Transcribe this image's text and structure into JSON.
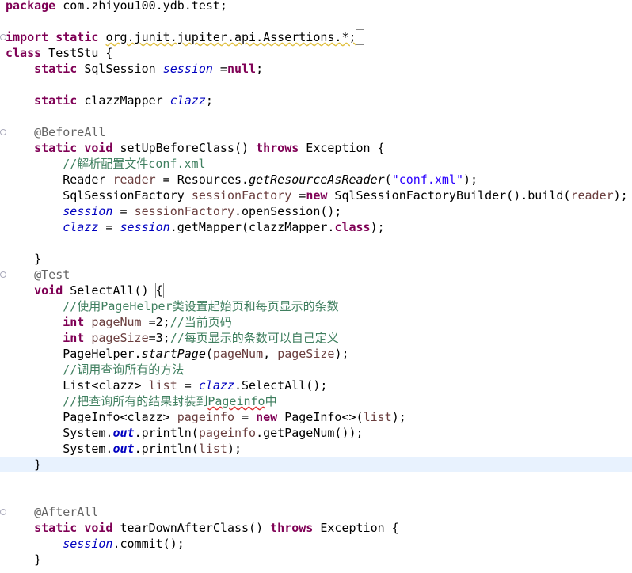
{
  "editor": {
    "current_line_color": "#e8f2fe",
    "lines": [
      {
        "t": [
          [
            "package",
            "kw"
          ],
          [
            " com.zhiyou100.ydb.test;",
            ""
          ]
        ]
      },
      {
        "t": []
      },
      {
        "fold": true,
        "t": [
          [
            "import",
            "kw"
          ],
          [
            " ",
            ""
          ],
          [
            "static",
            "kw"
          ],
          [
            " ",
            ""
          ],
          [
            "org.junit.jupiter.api.Assertions.*;",
            "sq"
          ],
          [
            " ",
            "box"
          ]
        ]
      },
      {
        "t": [
          [
            "class",
            "kw"
          ],
          [
            " TestStu {",
            ""
          ]
        ]
      },
      {
        "t": [
          [
            "    ",
            ""
          ],
          [
            "static",
            "kw"
          ],
          [
            " SqlSession ",
            ""
          ],
          [
            "session",
            "fld"
          ],
          [
            " =",
            ""
          ],
          [
            "null",
            "kw"
          ],
          [
            ";",
            ""
          ]
        ]
      },
      {
        "t": []
      },
      {
        "t": [
          [
            "    ",
            ""
          ],
          [
            "static",
            "kw"
          ],
          [
            " clazzMapper ",
            ""
          ],
          [
            "clazz",
            "fld"
          ],
          [
            ";",
            ""
          ]
        ]
      },
      {
        "t": []
      },
      {
        "fold": true,
        "t": [
          [
            "    ",
            ""
          ],
          [
            "@BeforeAll",
            "an"
          ]
        ]
      },
      {
        "t": [
          [
            "    ",
            ""
          ],
          [
            "static",
            "kw"
          ],
          [
            " ",
            ""
          ],
          [
            "void",
            "kw"
          ],
          [
            " setUpBeforeClass() ",
            ""
          ],
          [
            "throws",
            "kw"
          ],
          [
            " Exception {",
            ""
          ]
        ]
      },
      {
        "t": [
          [
            "        ",
            ""
          ],
          [
            "//解析配置文件conf.xml",
            "cm"
          ]
        ]
      },
      {
        "t": [
          [
            "        Reader ",
            ""
          ],
          [
            "reader",
            "lv"
          ],
          [
            " = Resources.",
            ""
          ],
          [
            "getResourceAsReader",
            "it"
          ],
          [
            "(",
            ""
          ],
          [
            "\"conf.xml\"",
            "st"
          ],
          [
            ");",
            ""
          ]
        ]
      },
      {
        "t": [
          [
            "        SqlSessionFactory ",
            ""
          ],
          [
            "sessionFactory",
            "lv"
          ],
          [
            " =",
            ""
          ],
          [
            "new",
            "kw"
          ],
          [
            " SqlSessionFactoryBuilder().build(",
            ""
          ],
          [
            "reader",
            "lv"
          ],
          [
            ");",
            ""
          ]
        ]
      },
      {
        "t": [
          [
            "        ",
            ""
          ],
          [
            "session",
            "fld"
          ],
          [
            " = ",
            ""
          ],
          [
            "sessionFactory",
            "lv"
          ],
          [
            ".openSession();",
            ""
          ]
        ]
      },
      {
        "t": [
          [
            "        ",
            ""
          ],
          [
            "clazz",
            "fld"
          ],
          [
            " = ",
            ""
          ],
          [
            "session",
            "fld"
          ],
          [
            ".getMapper(clazzMapper.",
            ""
          ],
          [
            "class",
            "kw"
          ],
          [
            ");",
            ""
          ]
        ]
      },
      {
        "t": []
      },
      {
        "t": [
          [
            "    }",
            ""
          ]
        ]
      },
      {
        "fold": true,
        "t": [
          [
            "    ",
            ""
          ],
          [
            "@Test",
            "an"
          ]
        ]
      },
      {
        "t": [
          [
            "    ",
            ""
          ],
          [
            "void",
            "kw"
          ],
          [
            " SelectAll() ",
            ""
          ],
          [
            "{",
            "box"
          ]
        ]
      },
      {
        "t": [
          [
            "        ",
            ""
          ],
          [
            "//使用PageHelper类设置起始页和每页显示的条数",
            "cm"
          ]
        ]
      },
      {
        "t": [
          [
            "        ",
            ""
          ],
          [
            "int",
            "kw"
          ],
          [
            " ",
            ""
          ],
          [
            "pageNum",
            "lv"
          ],
          [
            " =2;",
            ""
          ],
          [
            "//当前页码",
            "cm"
          ]
        ]
      },
      {
        "t": [
          [
            "        ",
            ""
          ],
          [
            "int",
            "kw"
          ],
          [
            " ",
            ""
          ],
          [
            "pageSize",
            "lv"
          ],
          [
            "=3;",
            ""
          ],
          [
            "//每页显示的条数可以自己定义",
            "cm"
          ]
        ]
      },
      {
        "t": [
          [
            "        PageHelper.",
            ""
          ],
          [
            "startPage",
            "it"
          ],
          [
            "(",
            ""
          ],
          [
            "pageNum",
            "lv"
          ],
          [
            ", ",
            ""
          ],
          [
            "pageSize",
            "lv"
          ],
          [
            ");",
            ""
          ]
        ]
      },
      {
        "t": [
          [
            "        ",
            ""
          ],
          [
            "//调用查询所有的方法",
            "cm"
          ]
        ]
      },
      {
        "t": [
          [
            "        List<clazz> ",
            ""
          ],
          [
            "list",
            "lv"
          ],
          [
            " = ",
            ""
          ],
          [
            "clazz",
            "fld"
          ],
          [
            ".SelectAll();",
            ""
          ]
        ]
      },
      {
        "t": [
          [
            "        ",
            ""
          ],
          [
            "//把查询所有的结果封装到",
            "cm"
          ],
          [
            "Pageinfo",
            "cm sqr"
          ],
          [
            "中",
            "cm"
          ]
        ]
      },
      {
        "t": [
          [
            "        PageInfo<clazz> ",
            ""
          ],
          [
            "pageinfo",
            "lv"
          ],
          [
            " = ",
            ""
          ],
          [
            "new",
            "kw"
          ],
          [
            " PageInfo<>(",
            ""
          ],
          [
            "list",
            "lv"
          ],
          [
            ");",
            ""
          ]
        ]
      },
      {
        "t": [
          [
            "        System.",
            ""
          ],
          [
            "out",
            "sf"
          ],
          [
            ".println(",
            ""
          ],
          [
            "pageinfo",
            "lv"
          ],
          [
            ".getPageNum());",
            ""
          ]
        ]
      },
      {
        "t": [
          [
            "        System.",
            ""
          ],
          [
            "out",
            "sf"
          ],
          [
            ".println(",
            ""
          ],
          [
            "list",
            "lv"
          ],
          [
            ");",
            ""
          ]
        ]
      },
      {
        "current": true,
        "t": [
          [
            "    }",
            ""
          ]
        ]
      },
      {
        "t": []
      },
      {
        "t": []
      },
      {
        "fold": true,
        "t": [
          [
            "    ",
            ""
          ],
          [
            "@AfterAll",
            "an"
          ]
        ]
      },
      {
        "t": [
          [
            "    ",
            ""
          ],
          [
            "static",
            "kw"
          ],
          [
            " ",
            ""
          ],
          [
            "void",
            "kw"
          ],
          [
            " tearDownAfterClass() ",
            ""
          ],
          [
            "throws",
            "kw"
          ],
          [
            " Exception {",
            ""
          ]
        ]
      },
      {
        "t": [
          [
            "        ",
            ""
          ],
          [
            "session",
            "fld"
          ],
          [
            ".commit();",
            ""
          ]
        ]
      },
      {
        "t": [
          [
            "    }",
            ""
          ]
        ]
      }
    ]
  }
}
